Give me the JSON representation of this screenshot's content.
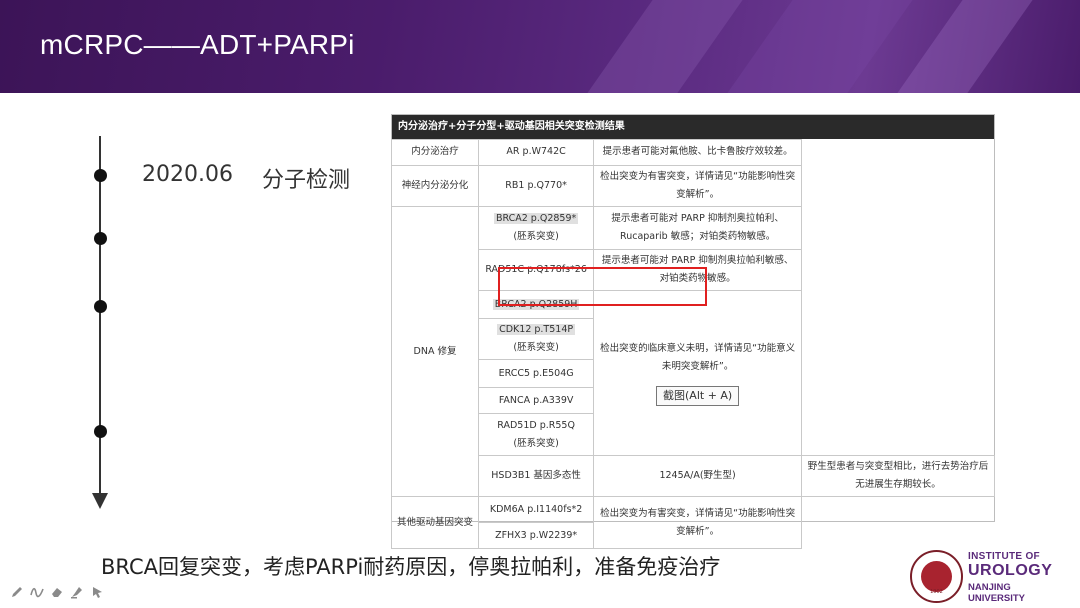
{
  "header": {
    "title": "mCRPC——ADT+PARPi"
  },
  "timeline": {
    "date": "2020.06",
    "event": "分子检测"
  },
  "report": {
    "heading": "内分泌治疗+分子分型+驱动基因相关突变检测结果",
    "rows": {
      "r1": {
        "category": "内分泌治疗",
        "gene": "AR  p.W742C",
        "note": "提示患者可能对氟他胺、比卡鲁胺疗效较差。"
      },
      "r2": {
        "category": "神经内分泌分化",
        "gene": "RB1  p.Q770*",
        "note": "检出突变为有害突变，详情请见“功能影响性突变解析”。"
      },
      "r3": {
        "category": "DNA 修复",
        "gene": "BRCA2  p.Q2859*",
        "sub": "(胚系突变)",
        "note": "提示患者可能对 PARP 抑制剂奥拉帕利、Rucaparib 敏感；对铂类药物敏感。"
      },
      "r4": {
        "gene": "RAD51C  p.Q178fs*26",
        "note": "提示患者可能对 PARP 抑制剂奥拉帕利敏感、对铂类药物敏感。"
      },
      "r5": {
        "gene": "BRCA2  p.Q2859H"
      },
      "r6": {
        "gene": "CDK12  p.T514P",
        "sub": "(胚系突变)",
        "note": "检出突变的临床意义未明，详情请见“功能意义未明突变解析”。",
        "button": "截图(Alt + A)"
      },
      "r7": {
        "gene": "ERCC5  p.E504G"
      },
      "r8": {
        "gene": "FANCA  p.A339V"
      },
      "r9": {
        "gene": "RAD51D  p.R55Q",
        "sub": "(胚系突变)"
      },
      "r10": {
        "category": "HSD3B1 基因多态性",
        "gene": "1245A/A(野生型)",
        "note": "野生型患者与突变型相比，进行去势治疗后无进展生存期较长。"
      },
      "r11": {
        "category": "其他驱动基因突变",
        "gene": "KDM6A  p.I1140fs*2",
        "note": "检出突变为有害突变，详情请见“功能影响性突变解析”。"
      },
      "r12": {
        "gene": "ZFHX3  p.W2239*"
      }
    }
  },
  "conclusion": "BRCA回复突变，考虑PARPi耐药原因，停奥拉帕利，准备免疫治疗",
  "logo": {
    "line1": "INSTITUTE OF",
    "line2": "UROLOGY",
    "line3": "NANJING",
    "line4": "UNIVERSITY",
    "year": "1902"
  },
  "tools": [
    "pen-icon",
    "draw-icon",
    "eraser-icon",
    "highlighter-icon",
    "pointer-icon"
  ],
  "colors": {
    "header": "#4a1c6b",
    "highlight_box": "#e02020",
    "logo": "#5a2a7a"
  }
}
